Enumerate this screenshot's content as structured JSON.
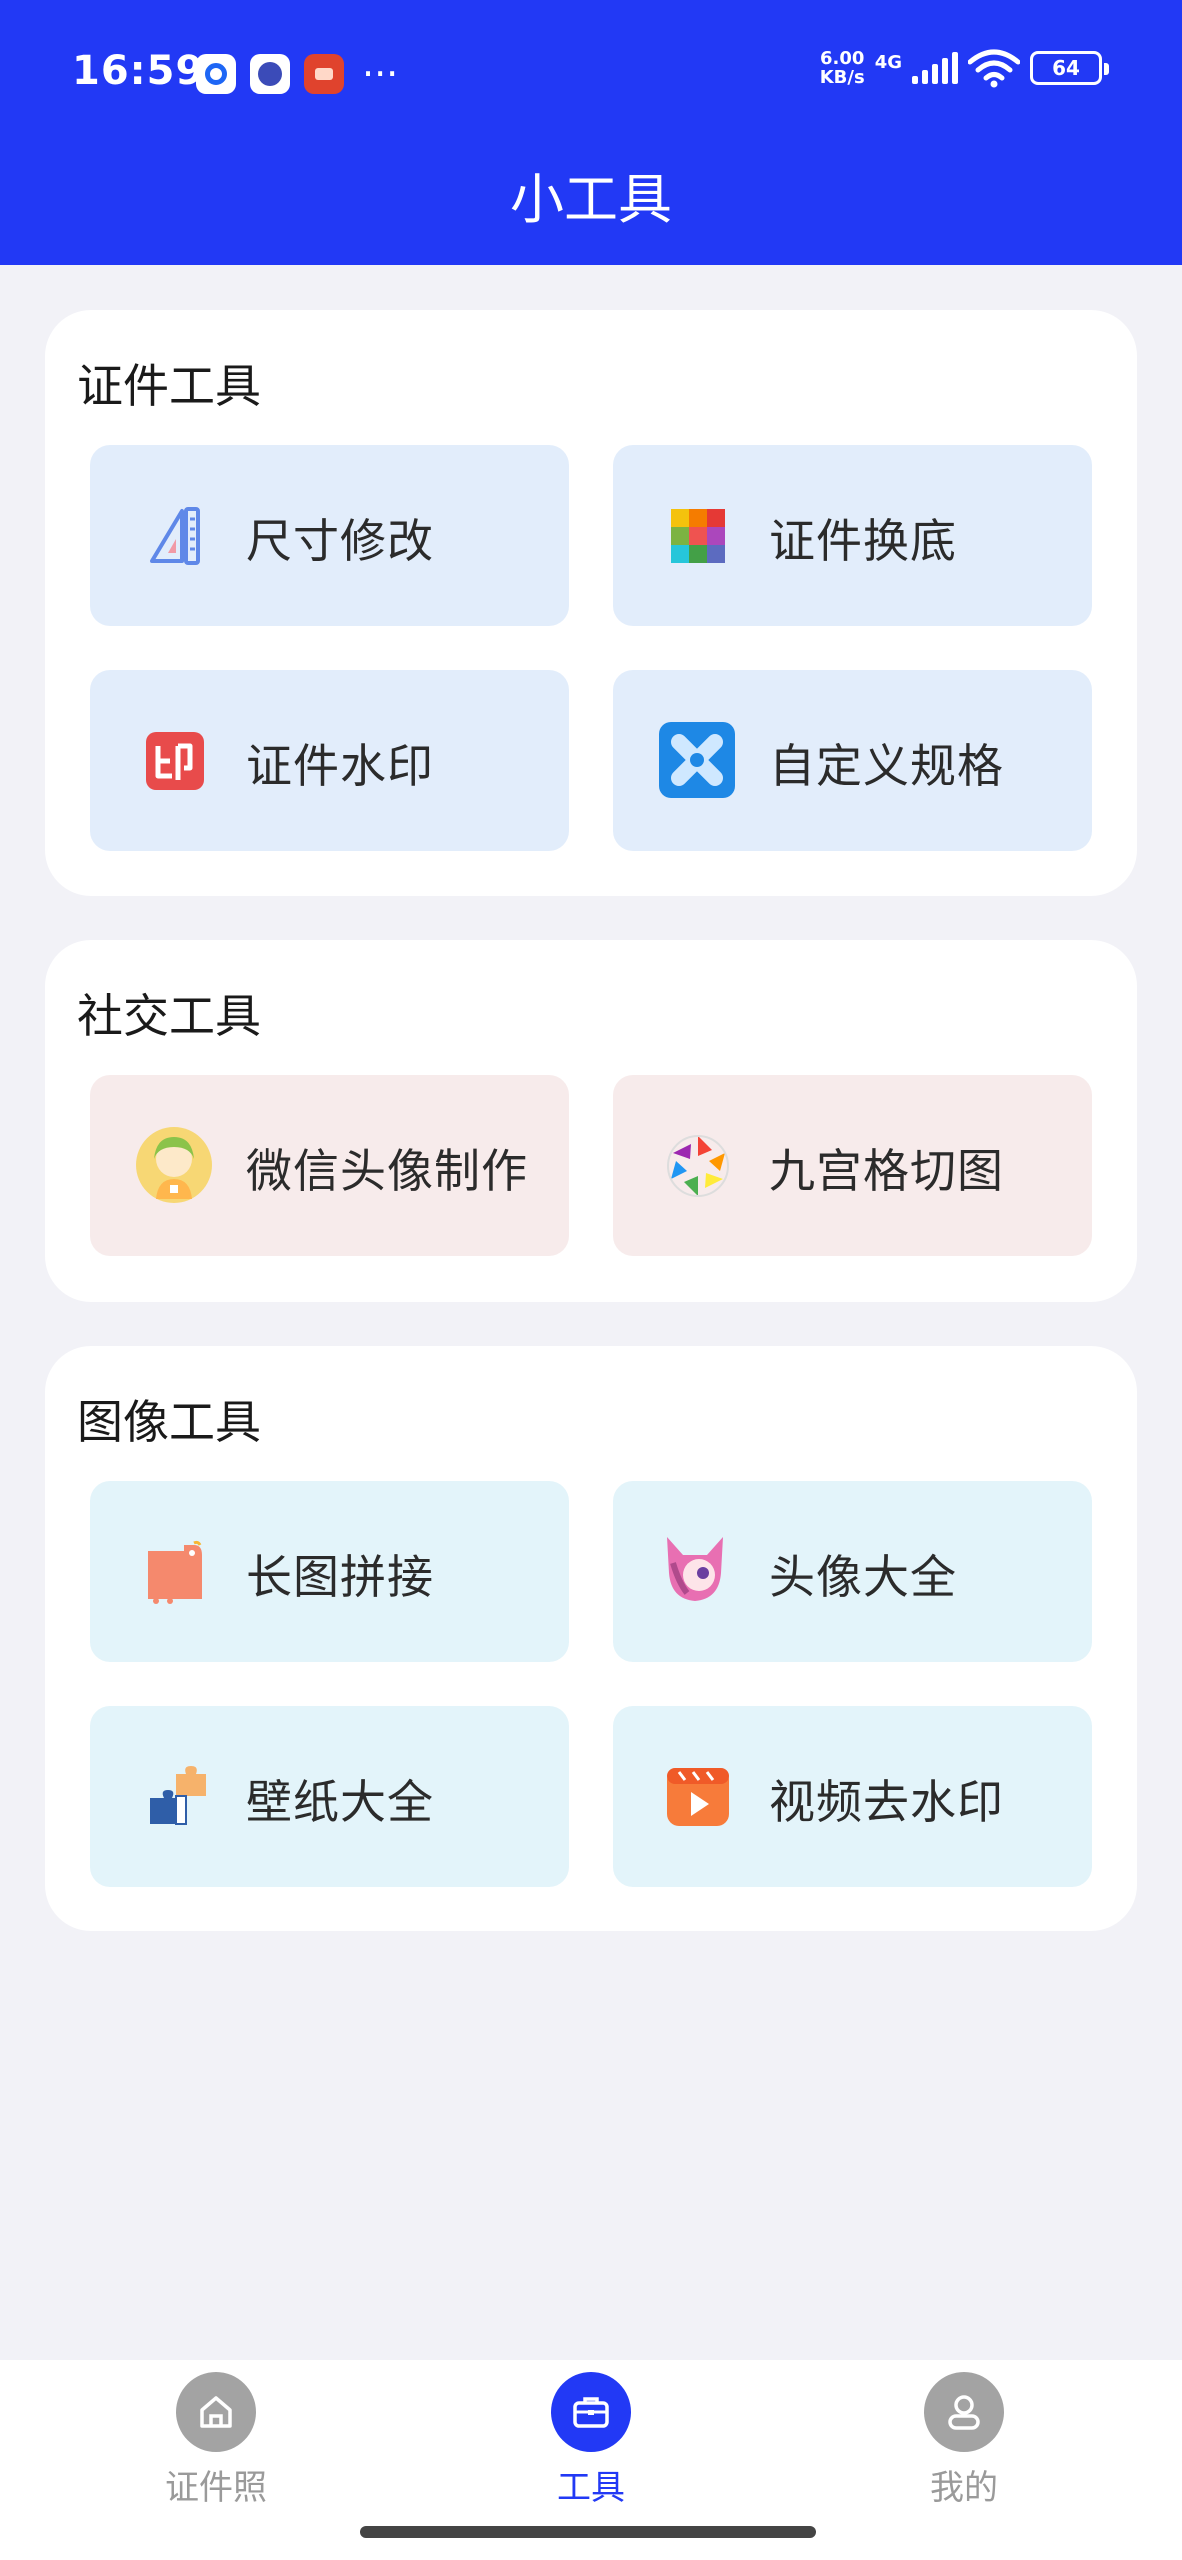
{
  "status_bar": {
    "time": "16:59",
    "net_speed_value": "6.00",
    "net_speed_unit": "KB/s",
    "network_type": "4G",
    "battery": "64",
    "more": "···"
  },
  "header": {
    "title": "小工具"
  },
  "sections": [
    {
      "title": "证件工具",
      "tools": [
        {
          "label": "尺寸修改",
          "icon": "ruler-icon"
        },
        {
          "label": "证件换底",
          "icon": "color-grid-icon"
        },
        {
          "label": "证件水印",
          "icon": "stamp-icon"
        },
        {
          "label": "自定义规格",
          "icon": "custom-spec-icon"
        }
      ]
    },
    {
      "title": "社交工具",
      "tools": [
        {
          "label": "微信头像制作",
          "icon": "avatar-girl-icon"
        },
        {
          "label": "九宫格切图",
          "icon": "aperture-icon"
        }
      ]
    },
    {
      "title": "图像工具",
      "tools": [
        {
          "label": "长图拼接",
          "icon": "long-image-icon"
        },
        {
          "label": "头像大全",
          "icon": "cat-avatar-icon"
        },
        {
          "label": "壁纸大全",
          "icon": "puzzle-icon"
        },
        {
          "label": "视频去水印",
          "icon": "video-play-icon"
        }
      ]
    }
  ],
  "tabbar": {
    "items": [
      {
        "label": "证件照",
        "icon": "home-icon",
        "active": false
      },
      {
        "label": "工具",
        "icon": "briefcase-icon",
        "active": true
      },
      {
        "label": "我的",
        "icon": "user-icon",
        "active": false
      }
    ]
  },
  "colors": {
    "accent": "#2239f5",
    "background": "#f2f2f7",
    "tile_blue": "#e2edfb",
    "tile_pink": "#f7ebeb",
    "tile_cyan": "#e3f4fa",
    "tab_inactive": "#a3a3a3"
  }
}
